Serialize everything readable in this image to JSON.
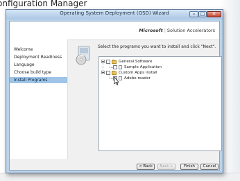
{
  "background_app": {
    "title": "onfiguration Manager"
  },
  "window": {
    "title": "Operating System Deployment (OSD) Wizard",
    "controls": {
      "minimize": "–",
      "maximize": "□",
      "close": "✕"
    }
  },
  "banner": {
    "brand_ms": "Microsoft",
    "brand_sep": "|",
    "brand_text": "Solution Accelerators"
  },
  "nav": {
    "items": [
      {
        "label": "Welcome"
      },
      {
        "label": "Deployment Readiness"
      },
      {
        "label": "Language"
      },
      {
        "label": "Choose build type"
      },
      {
        "label": "Install Programs"
      }
    ],
    "active_item": "Install Programs"
  },
  "main": {
    "instruction": "Select the programs you want to install and click \"Next\".",
    "tree": [
      {
        "label": "General Software",
        "type": "folder",
        "checked": false,
        "expanded": true
      },
      {
        "label": "Sample Application",
        "type": "application",
        "checked": false
      },
      {
        "label": "Custom Apps install",
        "type": "folder",
        "checked": false,
        "expanded": true
      },
      {
        "label": "Adobe reader",
        "type": "application",
        "checked": false
      }
    ]
  },
  "buttons": {
    "back": "< Back",
    "next": "Next >",
    "finish": "Finish",
    "cancel": "Cancel"
  },
  "colors": {
    "window_frame": "#bcd3ea",
    "nav_active": "#9fc4e8",
    "close_button": "#c4402d"
  }
}
